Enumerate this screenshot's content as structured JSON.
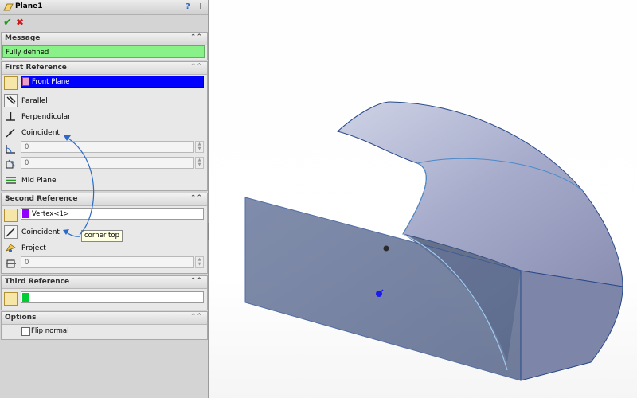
{
  "window": {
    "title": "Plane1",
    "help_glyph": "?",
    "pin_glyph": "⊣"
  },
  "actions": {
    "ok_glyph": "✔",
    "cancel_glyph": "✖"
  },
  "collapse_glyph": "⌃⌃",
  "message": {
    "header": "Message",
    "status": "Fully defined",
    "status_color": "#88f288"
  },
  "first_reference": {
    "header": "First Reference",
    "selection": "Front Plane",
    "selection_color": "#0000ff",
    "options": [
      "Parallel",
      "Perpendicular",
      "Coincident"
    ],
    "angle_value": "0",
    "distance_value": "0",
    "mid_plane": "Mid Plane"
  },
  "second_reference": {
    "header": "Second Reference",
    "selection": "Vertex<1>",
    "selection_color": "#9400ff",
    "options": [
      "Coincident",
      "Project"
    ],
    "value": "0"
  },
  "third_reference": {
    "header": "Third Reference",
    "selection": "",
    "selection_color": "#00cc33"
  },
  "options": {
    "header": "Options",
    "flip_normal_label": "Flip normal",
    "flip_normal_checked": false
  },
  "tooltip": "corner top"
}
